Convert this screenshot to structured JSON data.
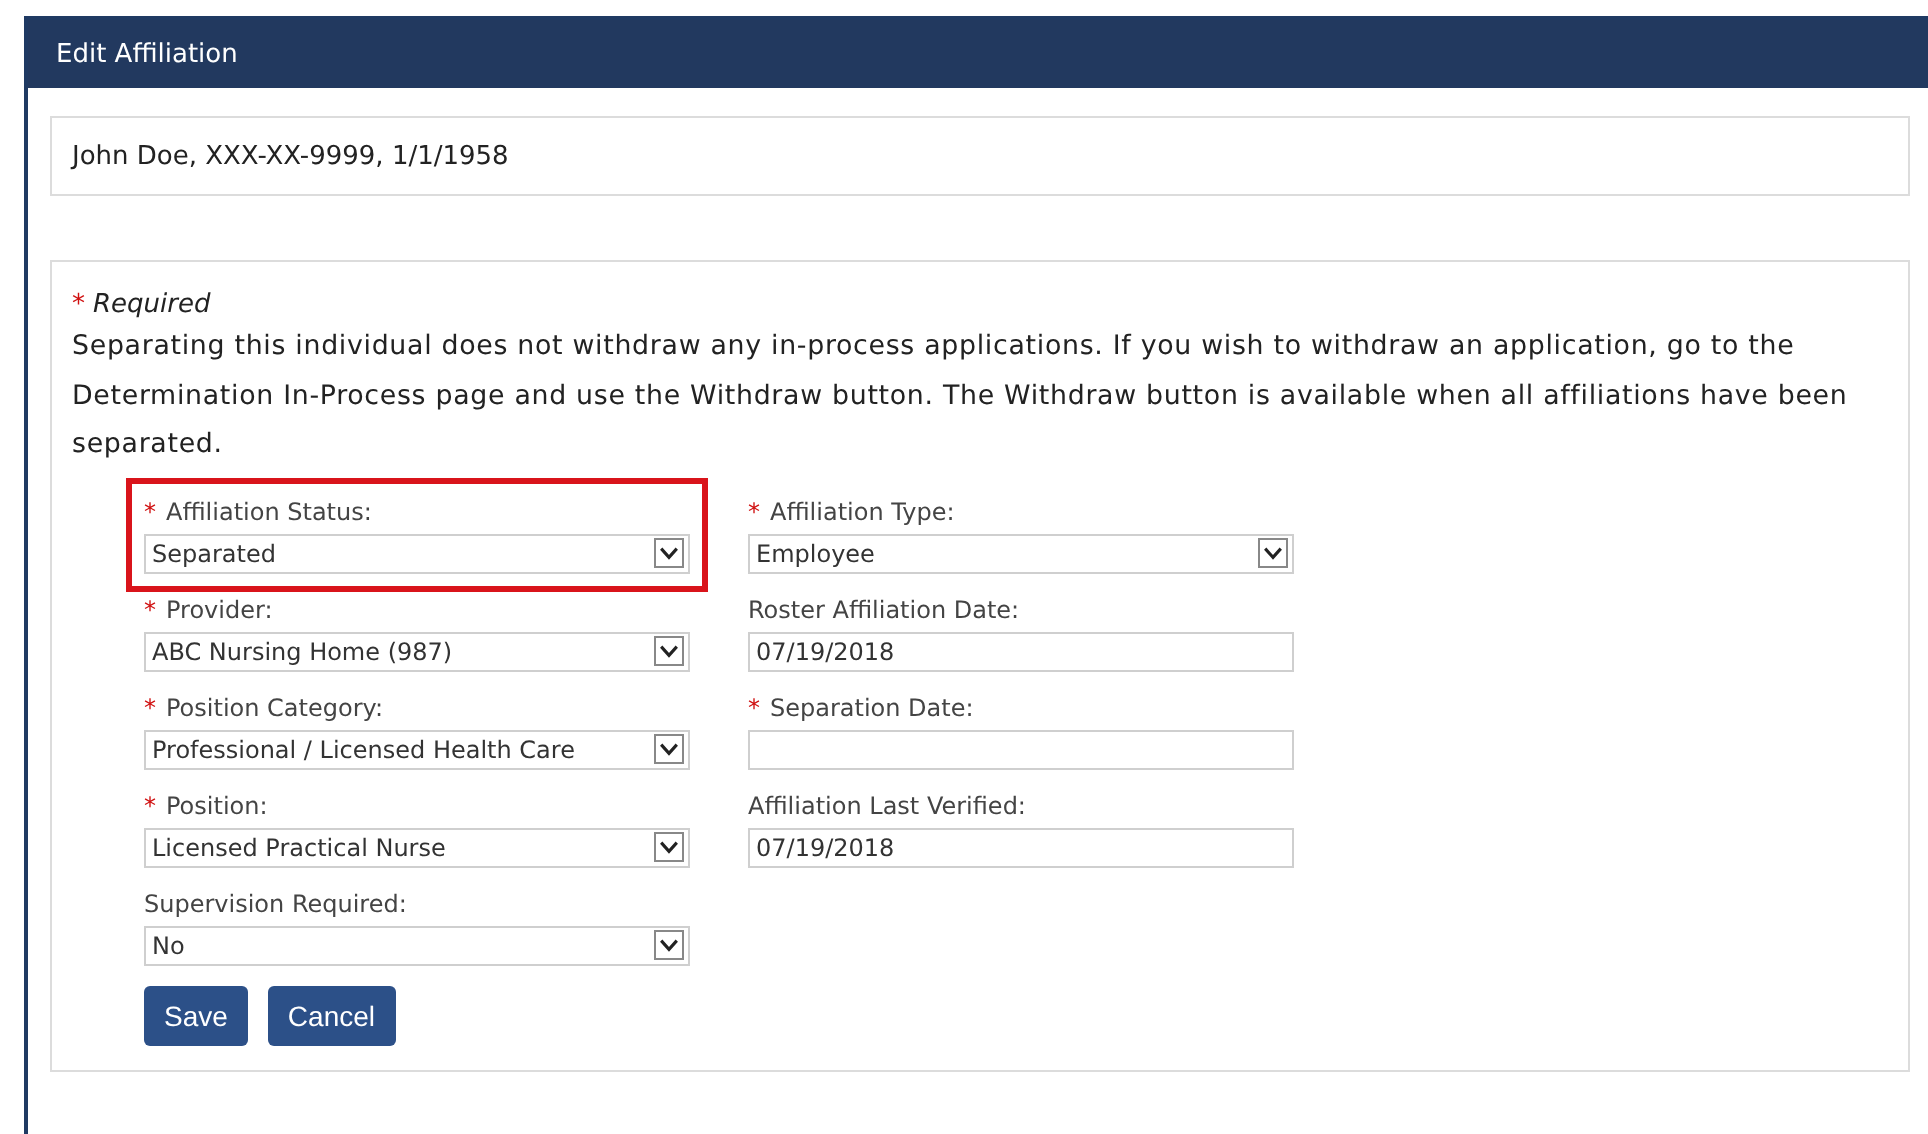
{
  "window": {
    "title": "Edit Affiliation"
  },
  "person": {
    "summary": "John Doe, XXX-XX-9999, 1/1/1958"
  },
  "notice": {
    "required_mark": "*",
    "required_label": "Required",
    "text": "Separating this individual does not withdraw any in-process applications. If you wish to withdraw an application, go to the Determination In-Process page and use the Withdraw button. The Withdraw button is available when all affiliations have been separated."
  },
  "form": {
    "columns": [
      [
        {
          "label": "Affiliation Status:",
          "required": true,
          "kind": "select",
          "value": "Separated",
          "highlighted": true
        },
        {
          "label": "Provider:",
          "required": true,
          "kind": "select",
          "value": "ABC Nursing Home (987)",
          "highlighted": false
        },
        {
          "label": "Position Category:",
          "required": true,
          "kind": "select",
          "value": "Professional / Licensed Health Care",
          "highlighted": false
        },
        {
          "label": "Position:",
          "required": true,
          "kind": "select",
          "value": "Licensed Practical Nurse",
          "highlighted": false
        },
        {
          "label": "Supervision Required:",
          "required": false,
          "kind": "select",
          "value": "No",
          "highlighted": false
        }
      ],
      [
        {
          "label": "Affiliation Type:",
          "required": true,
          "kind": "select",
          "value": "Employee",
          "highlighted": false
        },
        {
          "label": "Roster Affiliation Date:",
          "required": false,
          "kind": "text",
          "value": "07/19/2018",
          "highlighted": false
        },
        {
          "label": "Separation Date:",
          "required": true,
          "kind": "text",
          "highlighted": false
        },
        {
          "label": "Affiliation Last Verified:",
          "required": false,
          "kind": "text",
          "value": "07/19/2018",
          "highlighted": false
        }
      ]
    ]
  },
  "buttons": [
    "Save",
    "Cancel"
  ]
}
